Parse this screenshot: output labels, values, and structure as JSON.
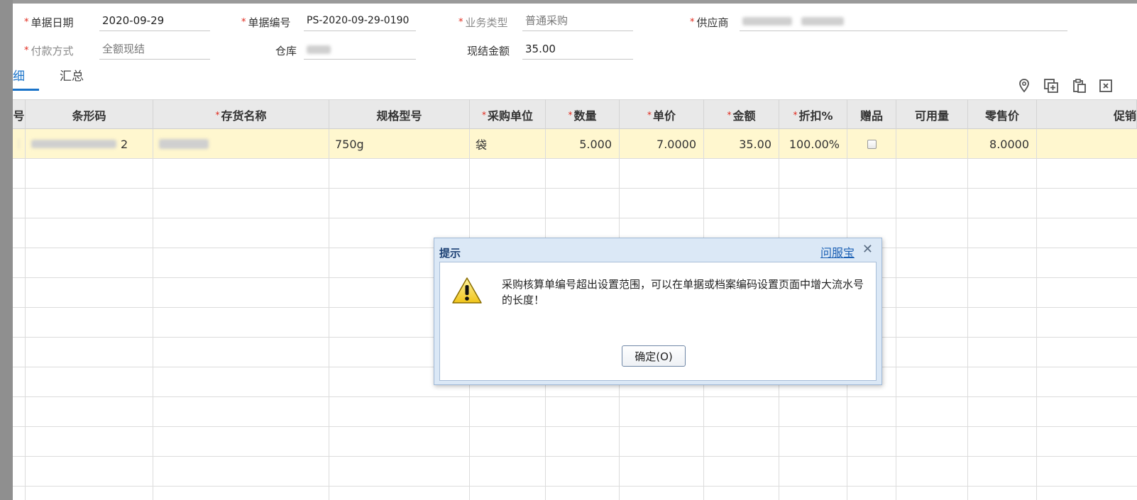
{
  "form": {
    "date": {
      "label": "单据日期",
      "value": "2020-09-29"
    },
    "doc_no": {
      "label": "单据编号",
      "value": "PS-2020-09-29-0190"
    },
    "biz_type": {
      "label": "业务类型",
      "value": "普通采购"
    },
    "supplier": {
      "label": "供应商"
    },
    "payment": {
      "label": "付款方式",
      "value": "全额现结"
    },
    "warehouse": {
      "label": "仓库"
    },
    "cash_amount": {
      "label": "现结金额",
      "value": "35.00"
    }
  },
  "tabs": [
    {
      "label": "细"
    },
    {
      "label": "汇总"
    }
  ],
  "toolbar": {
    "icons": [
      "location-icon",
      "add-copy-icon",
      "paste-icon",
      "export-icon"
    ]
  },
  "table": {
    "columns": [
      "号",
      "条形码",
      "存货名称",
      "规格型号",
      "采购单位",
      "数量",
      "单价",
      "金额",
      "折扣%",
      "赠品",
      "可用量",
      "零售价",
      "促销"
    ],
    "rows": [
      {
        "index": "",
        "barcode_suffix": "2",
        "spec": "750g",
        "unit": "袋",
        "qty": "5.000",
        "price": "7.0000",
        "amount": "35.00",
        "discount": "100.00%",
        "gift": false,
        "available": "",
        "retail_price": "8.0000",
        "promo": ""
      }
    ]
  },
  "dialog": {
    "title": "提示",
    "help_link": "问服宝",
    "close": "✕",
    "message": "采购核算单编号超出设置范围，可以在单据或档案编码设置页面中增大流水号的长度！",
    "ok_button": "确定(O)",
    "icon": "warning-icon"
  },
  "colors": {
    "accent": "#1a73c9",
    "required": "#e0281c",
    "selected_row": "#fff7cf",
    "dialog_frame": "#dbe8f6"
  }
}
